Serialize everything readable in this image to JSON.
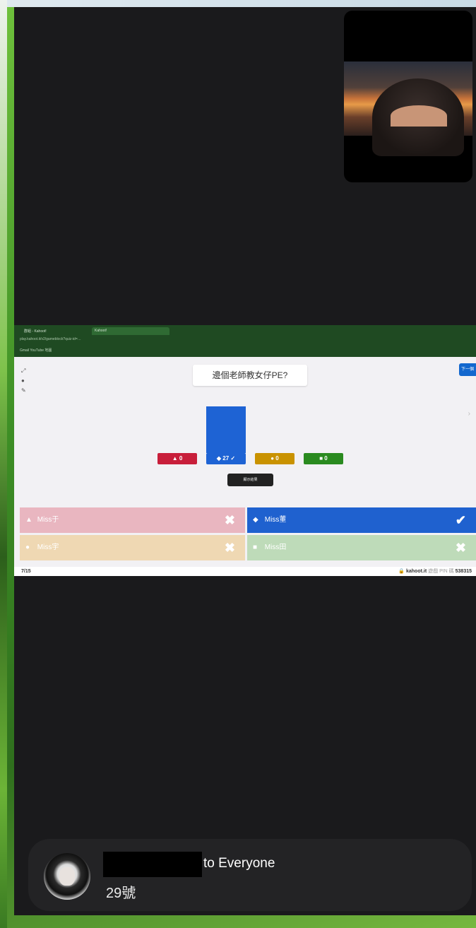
{
  "screen_share": {
    "browser": {
      "tab1": "群組 - Kahoot!",
      "tab2": "Kahoot!",
      "url": "play.kahoot.it/v2/gameblock?quiz-id=…",
      "bookmarks": "Gmail  YouTube  地圖"
    },
    "question": "邊個老師教女仔PE?",
    "side_tools": [
      "⤢",
      "●",
      "✎"
    ],
    "next_label": "下一個",
    "show_label": "顯示結果",
    "chart_data": {
      "type": "bar",
      "categories": [
        "▲",
        "◆",
        "●",
        "■"
      ],
      "values": [
        0,
        27,
        0,
        0
      ],
      "colors": [
        "#c81e3a",
        "#1e63d4",
        "#c99200",
        "#2a8a1f"
      ],
      "correct_index": 1,
      "labels": [
        "▲ 0",
        "◆ 27 ✓",
        "● 0",
        "■ 0"
      ]
    },
    "answers": [
      {
        "symbol": "▲",
        "text": "Miss于",
        "mark": "✖"
      },
      {
        "symbol": "◆",
        "text": "Miss董",
        "mark": "✔"
      },
      {
        "symbol": "●",
        "text": "Miss宇",
        "mark": "✖"
      },
      {
        "symbol": "■",
        "text": "Miss田",
        "mark": "✖"
      }
    ],
    "footer": {
      "counter": "7/15",
      "kahoot_host": "kahoot.it",
      "pin_label": "遊戲 PIN 碼",
      "pin": "538315"
    }
  },
  "chat": {
    "sender_suffix": "to Everyone",
    "message": "29號"
  }
}
